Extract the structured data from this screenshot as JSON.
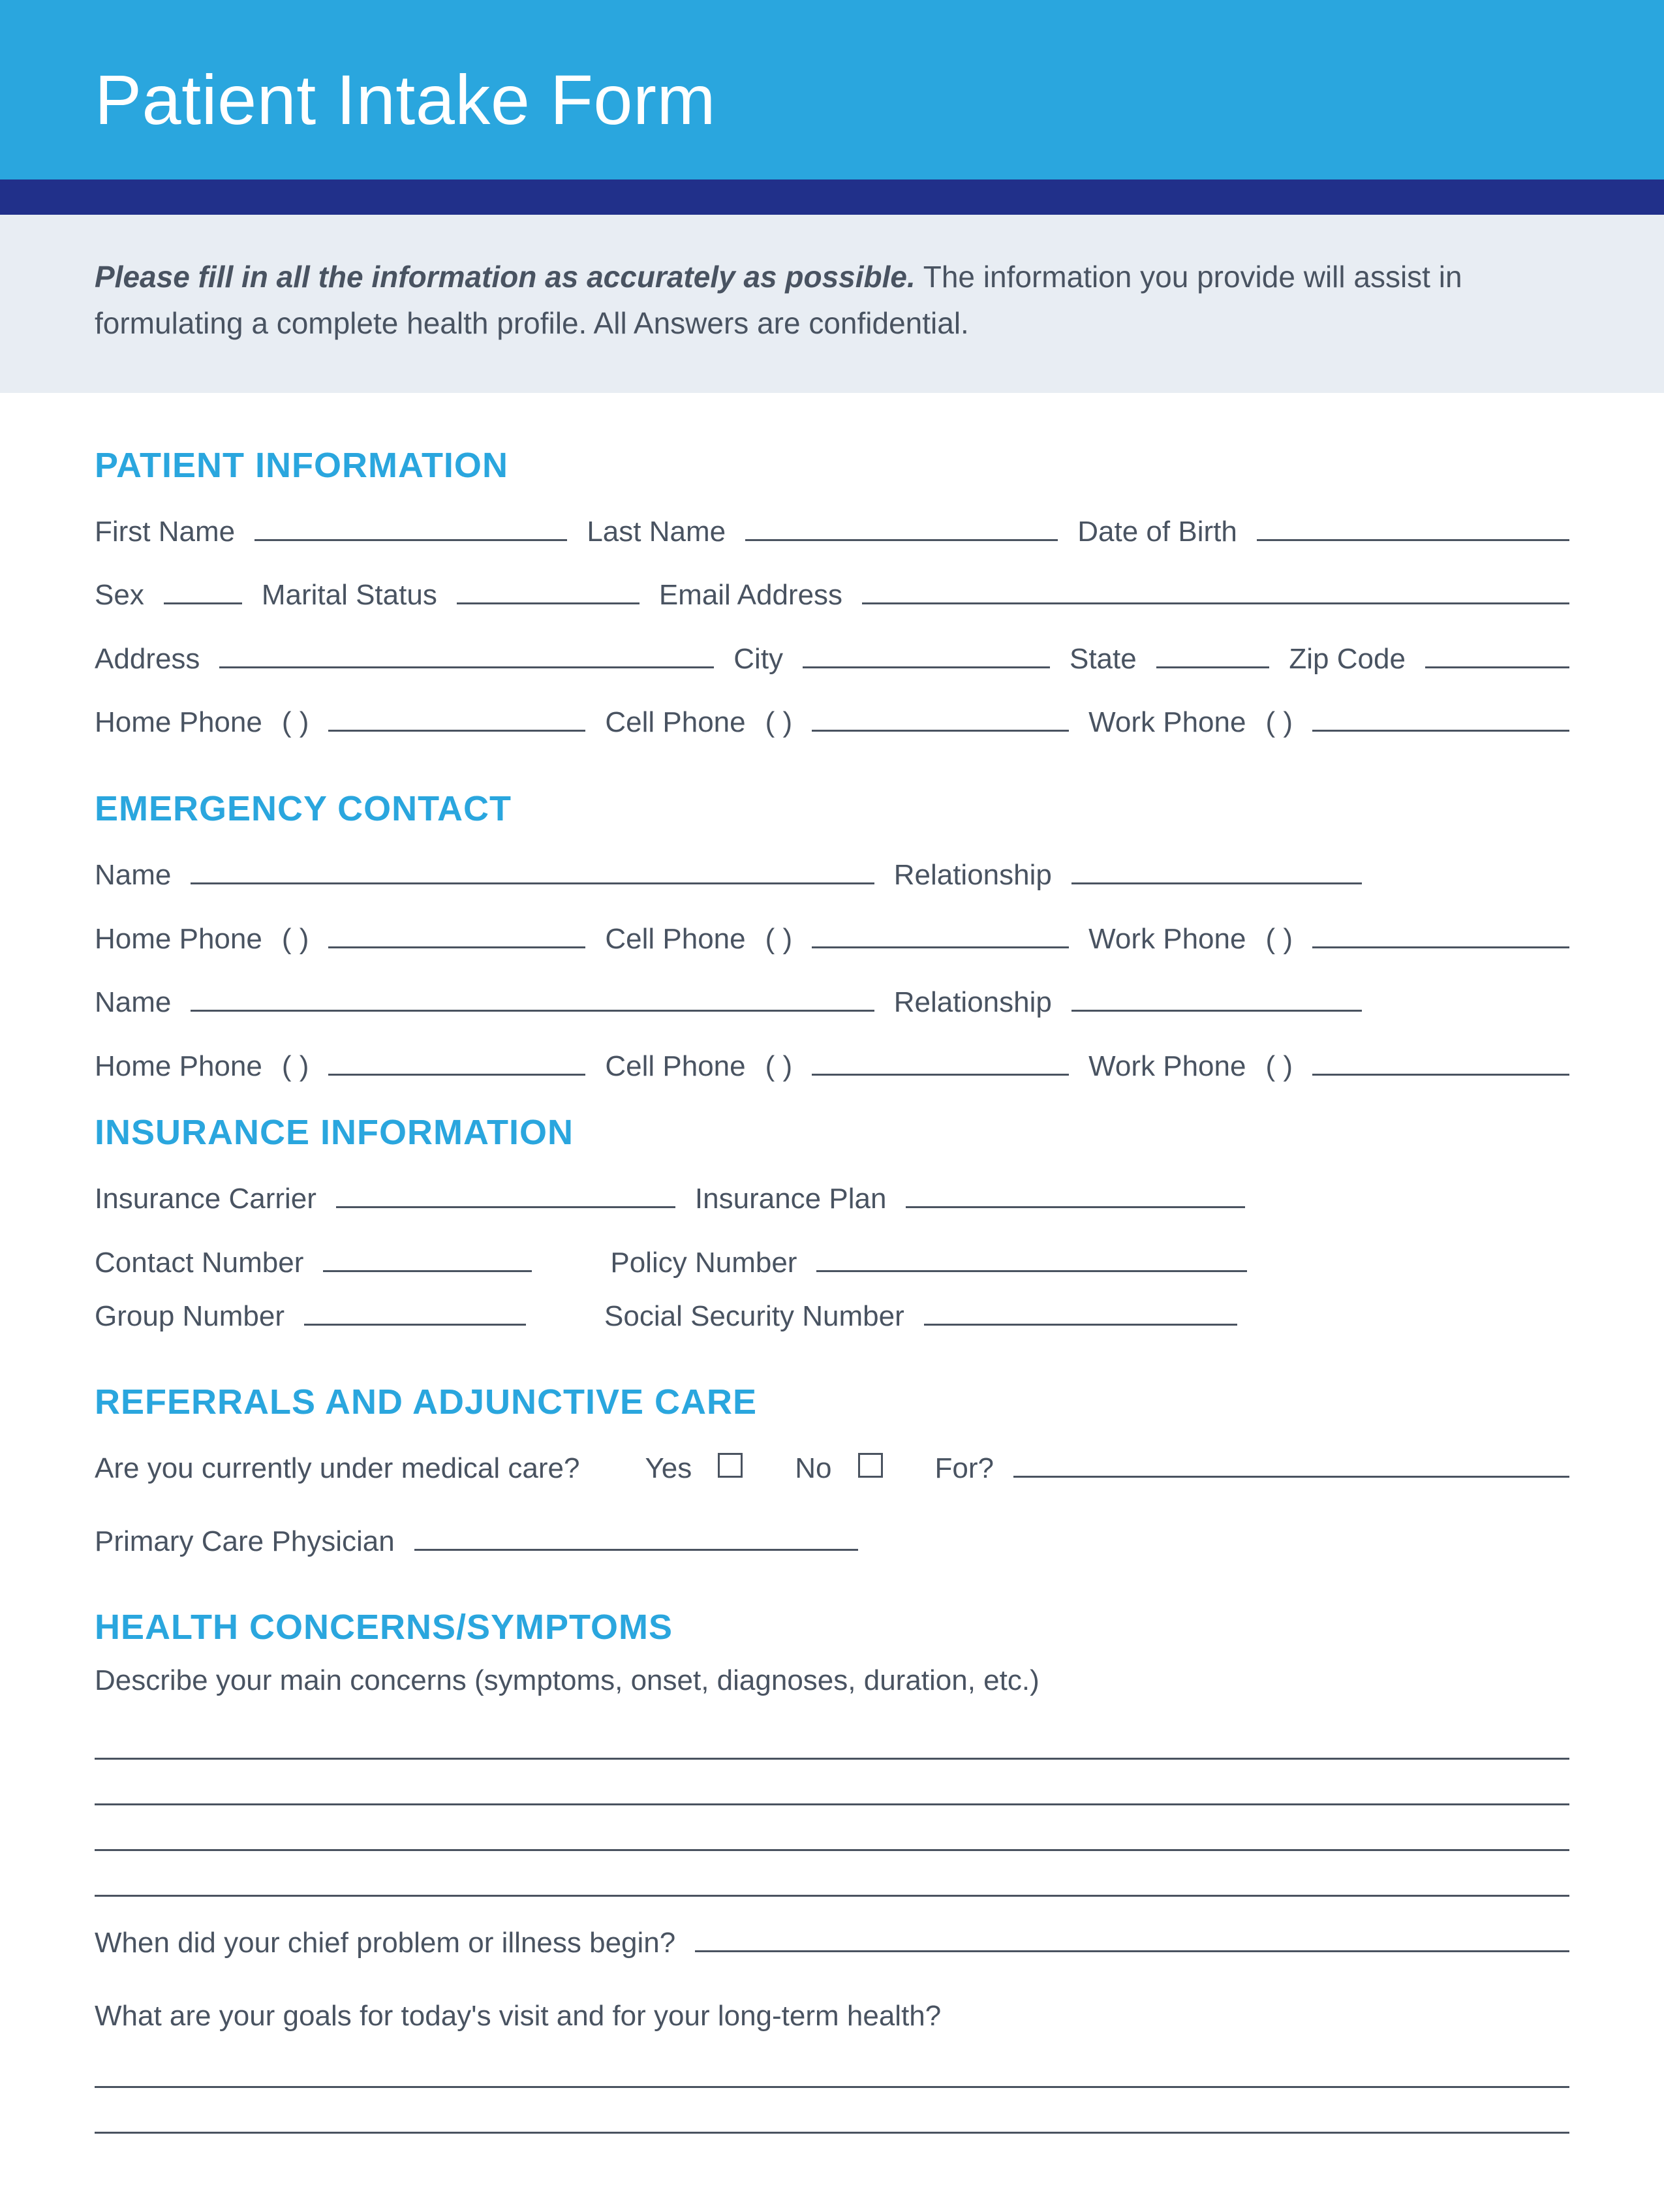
{
  "header": {
    "title": "Patient Intake Form"
  },
  "intro": {
    "lead": "Please fill in all the information as accurately as possible.",
    "rest": " The information you provide will assist in formulating a complete health profile. All Answers are confidential."
  },
  "sections": {
    "patient": {
      "title": "PATIENT INFORMATION",
      "first_name": "First Name",
      "last_name": "Last Name",
      "dob": "Date of Birth",
      "sex": "Sex",
      "marital": "Marital Status",
      "email": "Email Address",
      "address": "Address",
      "city": "City",
      "state": "State",
      "zip": "Zip Code",
      "home_phone": "Home Phone",
      "cell_phone": "Cell Phone",
      "work_phone": "Work Phone"
    },
    "emergency": {
      "title": "EMERGENCY CONTACT",
      "name": "Name",
      "relationship": "Relationship",
      "home_phone": "Home Phone",
      "cell_phone": "Cell Phone",
      "work_phone": "Work Phone"
    },
    "insurance": {
      "title": "INSURANCE INFORMATION",
      "carrier": "Insurance Carrier",
      "plan": "Insurance Plan",
      "contact": "Contact Number",
      "policy": "Policy Number",
      "group": "Group Number",
      "ssn": "Social Security Number"
    },
    "referrals": {
      "title": "REFERRALS AND ADJUNCTIVE CARE",
      "question": "Are you currently under medical care?",
      "yes": "Yes",
      "no": "No",
      "for": "For?",
      "pcp": "Primary Care Physician"
    },
    "health": {
      "title": "HEALTH CONCERNS/SYMPTOMS",
      "describe": "Describe your main concerns (symptoms, onset, diagnoses, duration, etc.)",
      "onset": "When did your chief problem or illness begin?",
      "goals": "What are your goals for today's visit and for your long-term health?"
    }
  },
  "phone_paren": "(        )"
}
